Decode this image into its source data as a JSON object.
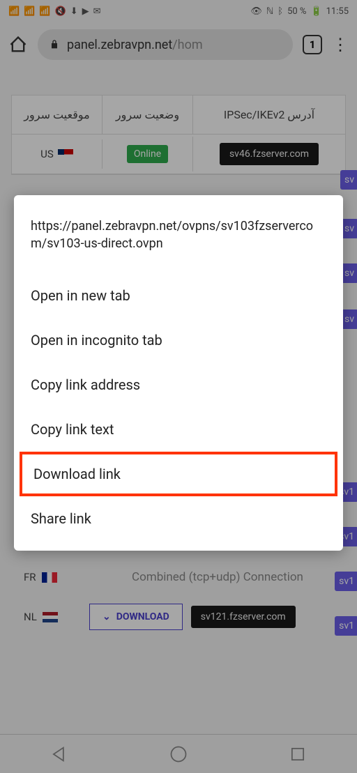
{
  "status_bar": {
    "battery_percent": "50 %",
    "time": "11:55"
  },
  "browser": {
    "url_host": "panel.zebravpn.net",
    "url_path": "/hom",
    "tab_count": "1"
  },
  "table": {
    "headers": {
      "location": "موقعیت سرور",
      "status": "وضعیت سرور",
      "ipsec": "IPSec/IKEv2 آدرس"
    },
    "row1": {
      "country": "US",
      "status": "Online",
      "server": "sv46.fzserver.com"
    },
    "combined_text": "Combined (tcp+udp) Connection",
    "download_btn": "DOWNLOAD",
    "fr": {
      "country": "FR"
    },
    "nl": {
      "country": "NL",
      "server": "sv121.fzserver.com"
    }
  },
  "purple_badges": {
    "b1": "sv",
    "b2": "sv",
    "b3": "sv",
    "b4": "sv",
    "b5": "sv1",
    "b6": "sv1",
    "b7": "sv1",
    "b8": "sv1"
  },
  "context_menu": {
    "url": "https://panel.zebravpn.net/ovpns/sv103fzservercom/sv103-us-direct.ovpn",
    "items": {
      "open_new_tab": "Open in new tab",
      "open_incognito": "Open in incognito tab",
      "copy_address": "Copy link address",
      "copy_text": "Copy link text",
      "download": "Download link",
      "share": "Share link"
    }
  }
}
